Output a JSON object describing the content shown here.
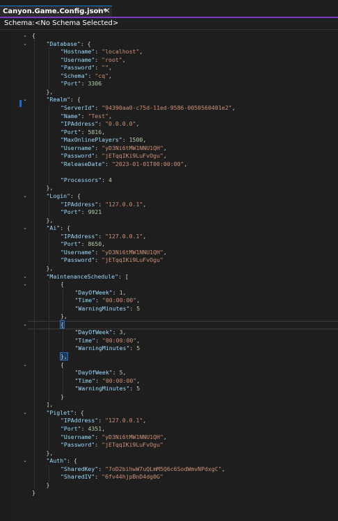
{
  "tab": {
    "title": "Canyon.Game.Config.json*",
    "pin_glyph": "⊣",
    "close_glyph": "✕"
  },
  "schema": {
    "label": "Schema:",
    "value": "<No Schema Selected>"
  },
  "lines": [
    [
      [
        "p",
        "{"
      ]
    ],
    [
      [
        "k",
        "\"Database\""
      ],
      [
        "p",
        ": {"
      ]
    ],
    [
      [
        "k",
        "\"Hostname\""
      ],
      [
        "p",
        ": "
      ],
      [
        "s",
        "\"localhost\""
      ],
      [
        "p",
        ","
      ]
    ],
    [
      [
        "k",
        "\"Username\""
      ],
      [
        "p",
        ": "
      ],
      [
        "s",
        "\"root\""
      ],
      [
        "p",
        ","
      ]
    ],
    [
      [
        "k",
        "\"Password\""
      ],
      [
        "p",
        ": "
      ],
      [
        "s",
        "\"\""
      ],
      [
        "p",
        ","
      ]
    ],
    [
      [
        "k",
        "\"Schema\""
      ],
      [
        "p",
        ": "
      ],
      [
        "s",
        "\"cq\""
      ],
      [
        "p",
        ","
      ]
    ],
    [
      [
        "k",
        "\"Port\""
      ],
      [
        "p",
        ": "
      ],
      [
        "n",
        "3306"
      ]
    ],
    [
      [
        "p",
        "},"
      ]
    ],
    [
      [
        "k",
        "\"Realm\""
      ],
      [
        "p",
        ": {"
      ]
    ],
    [
      [
        "k",
        "\"ServerId\""
      ],
      [
        "p",
        ": "
      ],
      [
        "s",
        "\"94390aa0-c75d-11ed-9586-0050560401e2\""
      ],
      [
        "p",
        ","
      ]
    ],
    [
      [
        "k",
        "\"Name\""
      ],
      [
        "p",
        ": "
      ],
      [
        "s",
        "\"Test\""
      ],
      [
        "p",
        ","
      ]
    ],
    [
      [
        "k",
        "\"IPAddress\""
      ],
      [
        "p",
        ": "
      ],
      [
        "s",
        "\"0.0.0.0\""
      ],
      [
        "p",
        ","
      ]
    ],
    [
      [
        "k",
        "\"Port\""
      ],
      [
        "p",
        ": "
      ],
      [
        "n",
        "5816"
      ],
      [
        "p",
        ","
      ]
    ],
    [
      [
        "k",
        "\"MaxOnlinePlayers\""
      ],
      [
        "p",
        ": "
      ],
      [
        "n",
        "1500"
      ],
      [
        "p",
        ","
      ]
    ],
    [
      [
        "k",
        "\"Username\""
      ],
      [
        "p",
        ": "
      ],
      [
        "s",
        "\"yD3Ni6tMW1NNU1QH\""
      ],
      [
        "p",
        ","
      ]
    ],
    [
      [
        "k",
        "\"Password\""
      ],
      [
        "p",
        ": "
      ],
      [
        "s",
        "\"jETqqIKi9LuFvOgu\""
      ],
      [
        "p",
        ","
      ]
    ],
    [
      [
        "k",
        "\"ReleaseDate\""
      ],
      [
        "p",
        ": "
      ],
      [
        "s",
        "\"2023-01-01T00:00:00\""
      ],
      [
        "p",
        ","
      ]
    ],
    [],
    [
      [
        "k",
        "\"Processors\""
      ],
      [
        "p",
        ": "
      ],
      [
        "n",
        "4"
      ]
    ],
    [
      [
        "p",
        "},"
      ]
    ],
    [
      [
        "k",
        "\"Login\""
      ],
      [
        "p",
        ": {"
      ]
    ],
    [
      [
        "k",
        "\"IPAddress\""
      ],
      [
        "p",
        ": "
      ],
      [
        "s",
        "\"127.0.0.1\""
      ],
      [
        "p",
        ","
      ]
    ],
    [
      [
        "k",
        "\"Port\""
      ],
      [
        "p",
        ": "
      ],
      [
        "n",
        "9921"
      ]
    ],
    [
      [
        "p",
        "},"
      ]
    ],
    [
      [
        "k",
        "\"Ai\""
      ],
      [
        "p",
        ": {"
      ]
    ],
    [
      [
        "k",
        "\"IPAddress\""
      ],
      [
        "p",
        ": "
      ],
      [
        "s",
        "\"127.0.0.1\""
      ],
      [
        "p",
        ","
      ]
    ],
    [
      [
        "k",
        "\"Port\""
      ],
      [
        "p",
        ": "
      ],
      [
        "n",
        "8650"
      ],
      [
        "p",
        ","
      ]
    ],
    [
      [
        "k",
        "\"Username\""
      ],
      [
        "p",
        ": "
      ],
      [
        "s",
        "\"yD3Ni6tMW1NNU1QH\""
      ],
      [
        "p",
        ","
      ]
    ],
    [
      [
        "k",
        "\"Password\""
      ],
      [
        "p",
        ": "
      ],
      [
        "s",
        "\"jETqqIKi9LuFvOgu\""
      ]
    ],
    [
      [
        "p",
        "},"
      ]
    ],
    [
      [
        "k",
        "\"MaintenanceSchedule\""
      ],
      [
        "p",
        ": ["
      ]
    ],
    [
      [
        "p",
        "{"
      ]
    ],
    [
      [
        "k",
        "\"DayOfWeek\""
      ],
      [
        "p",
        ": "
      ],
      [
        "n",
        "1"
      ],
      [
        "p",
        ","
      ]
    ],
    [
      [
        "k",
        "\"Time\""
      ],
      [
        "p",
        ": "
      ],
      [
        "s",
        "\"00:00:00\""
      ],
      [
        "p",
        ","
      ]
    ],
    [
      [
        "k",
        "\"WarningMinutes\""
      ],
      [
        "p",
        ": "
      ],
      [
        "n",
        "5"
      ]
    ],
    [
      [
        "p",
        "},"
      ]
    ],
    [
      [
        "p",
        "{"
      ]
    ],
    [
      [
        "k",
        "\"DayOfWeek\""
      ],
      [
        "p",
        ": "
      ],
      [
        "n",
        "3"
      ],
      [
        "p",
        ","
      ]
    ],
    [
      [
        "k",
        "\"Time\""
      ],
      [
        "p",
        ": "
      ],
      [
        "s",
        "\"00:00:00\""
      ],
      [
        "p",
        ","
      ]
    ],
    [
      [
        "k",
        "\"WarningMinutes\""
      ],
      [
        "p",
        ": "
      ],
      [
        "n",
        "5"
      ]
    ],
    [
      [
        "p",
        "},"
      ]
    ],
    [
      [
        "p",
        "{"
      ]
    ],
    [
      [
        "k",
        "\"DayOfWeek\""
      ],
      [
        "p",
        ": "
      ],
      [
        "n",
        "5"
      ],
      [
        "p",
        ","
      ]
    ],
    [
      [
        "k",
        "\"Time\""
      ],
      [
        "p",
        ": "
      ],
      [
        "s",
        "\"00:00:00\""
      ],
      [
        "p",
        ","
      ]
    ],
    [
      [
        "k",
        "\"WarningMinutes\""
      ],
      [
        "p",
        ": "
      ],
      [
        "n",
        "5"
      ]
    ],
    [
      [
        "p",
        "}"
      ]
    ],
    [
      [
        "p",
        "],"
      ]
    ],
    [
      [
        "k",
        "\"Piglet\""
      ],
      [
        "p",
        ": {"
      ]
    ],
    [
      [
        "k",
        "\"IPAddress\""
      ],
      [
        "p",
        ": "
      ],
      [
        "s",
        "\"127.0.0.1\""
      ],
      [
        "p",
        ","
      ]
    ],
    [
      [
        "k",
        "\"Port\""
      ],
      [
        "p",
        ": "
      ],
      [
        "n",
        "4351"
      ],
      [
        "p",
        ","
      ]
    ],
    [
      [
        "k",
        "\"Username\""
      ],
      [
        "p",
        ": "
      ],
      [
        "s",
        "\"yD3Ni6tMW1NNU1QH\""
      ],
      [
        "p",
        ","
      ]
    ],
    [
      [
        "k",
        "\"Password\""
      ],
      [
        "p",
        ": "
      ],
      [
        "s",
        "\"jETqqIKi9LuFvOgu\""
      ]
    ],
    [
      [
        "p",
        "},"
      ]
    ],
    [
      [
        "k",
        "\"Auth\""
      ],
      [
        "p",
        ": {"
      ]
    ],
    [
      [
        "k",
        "\"SharedKey\""
      ],
      [
        "p",
        ": "
      ],
      [
        "s",
        "\"7oD2bihwW7uQLmM5Q6c6SodWmvNPdxgC\""
      ],
      [
        "p",
        ","
      ]
    ],
    [
      [
        "k",
        "\"SharedIV\""
      ],
      [
        "p",
        ": "
      ],
      [
        "s",
        "\"6fv44hjpBnD4dg0G\""
      ]
    ],
    [
      [
        "p",
        "}"
      ]
    ],
    [
      [
        "p",
        "}"
      ]
    ]
  ],
  "colors": {
    "key": "#9cdcfe",
    "string": "#ce9178",
    "number": "#b5cea8",
    "punct": "#d4d4d4",
    "tab_accent": "#7b3bc8"
  }
}
